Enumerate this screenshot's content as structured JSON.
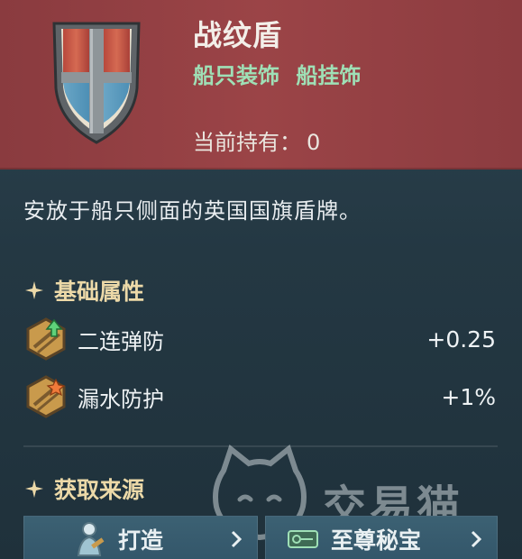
{
  "item": {
    "name": "战纹盾",
    "tags": [
      "船只装饰",
      "船挂饰"
    ],
    "owned_label": "当前持有：",
    "owned_count": "0",
    "description": "安放于船只侧面的英国国旗盾牌。"
  },
  "attributes": {
    "title": "基础属性",
    "rows": [
      {
        "name": "二连弹防",
        "value": "+0.25",
        "icon": "wood-plank-arrow-up-icon"
      },
      {
        "name": "漏水防护",
        "value": "+1%",
        "icon": "wood-plank-spark-icon"
      }
    ]
  },
  "sources": {
    "title": "获取来源",
    "buttons": [
      {
        "label": "打造",
        "icon": "craft-figure-icon"
      },
      {
        "label": "至尊秘宝",
        "icon": "ticket-icon"
      }
    ]
  },
  "watermark": {
    "text": "交易猫"
  },
  "colors": {
    "header_bg": "#9b4447",
    "tag_green": "#9fe0b6",
    "section_gold": "#ecd9a8",
    "panel_bg": "#243843"
  }
}
